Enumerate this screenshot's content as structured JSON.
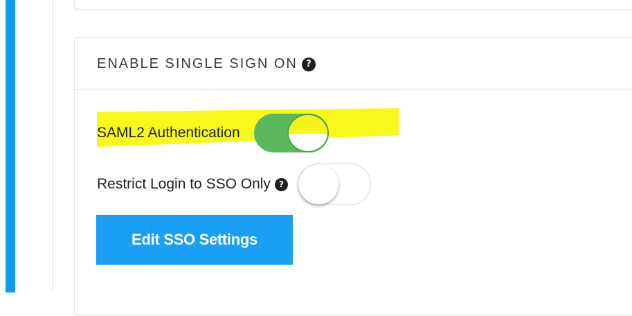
{
  "section": {
    "title": "ENABLE SINGLE SIGN ON",
    "help_glyph": "?"
  },
  "saml": {
    "label": "SAML2 Authentication",
    "enabled": true
  },
  "restrict": {
    "label": "Restrict Login to SSO Only",
    "help_glyph": "?",
    "enabled": false
  },
  "edit_button": {
    "label": "Edit SSO Settings"
  },
  "colors": {
    "accent": "#0b9cf2",
    "button": "#1a9ff5",
    "toggle_on": "#5cb85c",
    "highlight": "#f8f81c"
  },
  "icons": {
    "help": "help-circle-icon"
  }
}
